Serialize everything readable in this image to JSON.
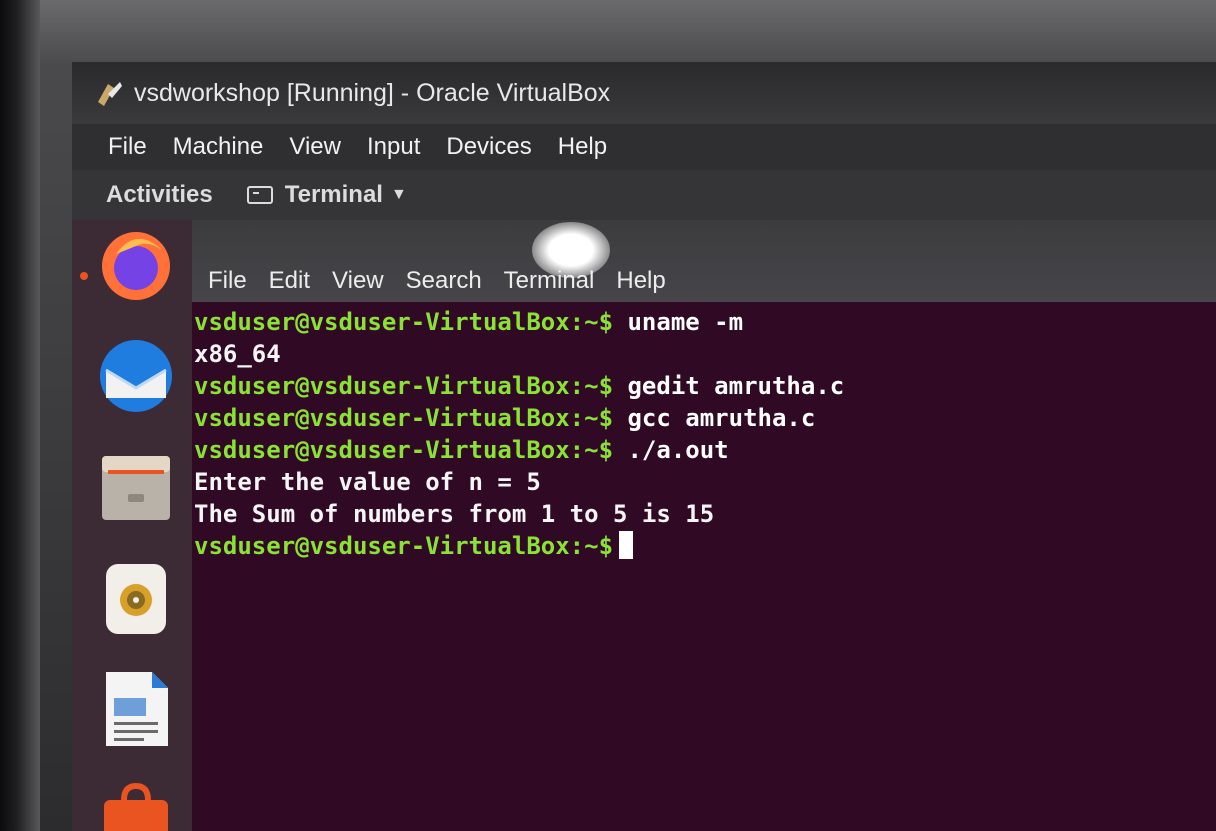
{
  "window": {
    "title": "vsdworkshop [Running] - Oracle VirtualBox",
    "menu": [
      "File",
      "Machine",
      "View",
      "Input",
      "Devices",
      "Help"
    ]
  },
  "topbar": {
    "activities": "Activities",
    "app_name": "Terminal"
  },
  "dock": {
    "items": [
      "firefox-icon",
      "thunderbird-icon",
      "files-icon",
      "rhythmbox-icon",
      "libreoffice-writer-icon",
      "software-icon"
    ]
  },
  "terminal": {
    "menu": [
      "File",
      "Edit",
      "View",
      "Search",
      "Terminal",
      "Help"
    ],
    "prompt": "vsduser@vsduser-VirtualBox:~$",
    "lines": [
      {
        "type": "cmd",
        "text": " uname -m"
      },
      {
        "type": "out",
        "text": "x86_64"
      },
      {
        "type": "cmd",
        "text": " gedit amrutha.c"
      },
      {
        "type": "cmd",
        "text": " gcc amrutha.c"
      },
      {
        "type": "cmd",
        "text": " ./a.out"
      },
      {
        "type": "out",
        "text": "Enter the value of n = 5"
      },
      {
        "type": "out",
        "text": "The Sum of numbers from 1 to 5 is 15"
      }
    ]
  },
  "colors": {
    "terminal_bg": "#300a24",
    "prompt": "#8ae234",
    "accent": "#e95420"
  }
}
